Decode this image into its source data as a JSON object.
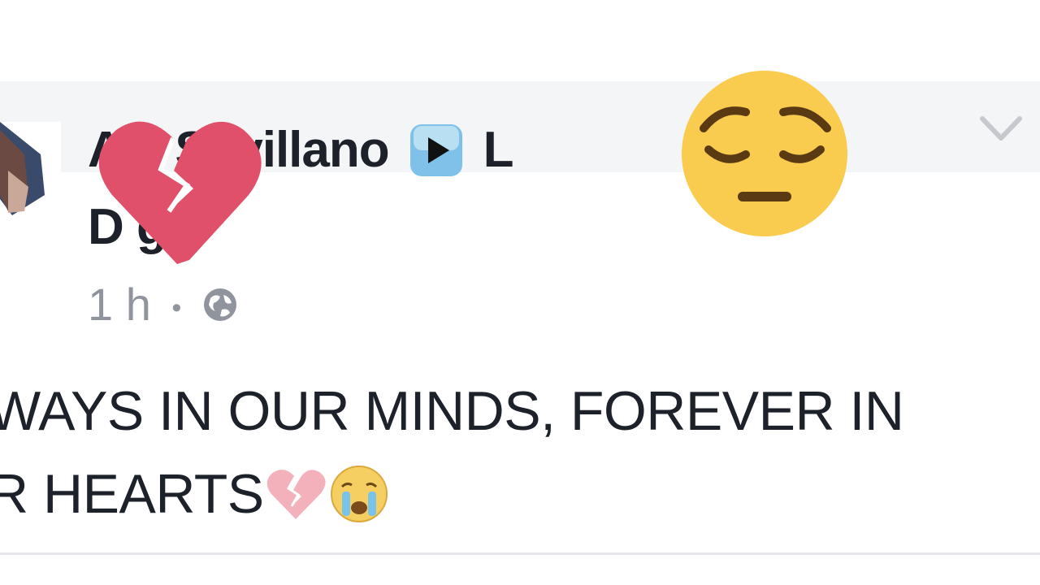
{
  "post": {
    "author_line1_visible": "A        y Sevillano",
    "author_line1_suffix": "L",
    "author_line2_visible": "D      g",
    "time": "1 h",
    "separator": "•",
    "text_line1": "WAYS IN OUR MINDS, FOREVER IN",
    "text_line2": "R HEARTS"
  },
  "icons": {
    "play": "play-button-icon",
    "globe": "globe-icon",
    "chevron": "chevron-down-icon",
    "broken_heart": "broken-heart-emoji",
    "crying": "crying-face-emoji",
    "pensive": "pensive-face-emoji"
  },
  "colors": {
    "text": "#1d2129",
    "meta": "#90949c",
    "band": "#f4f5f7",
    "broken_heart": "#e0506a",
    "pensive_face": "#f9cb4f"
  }
}
